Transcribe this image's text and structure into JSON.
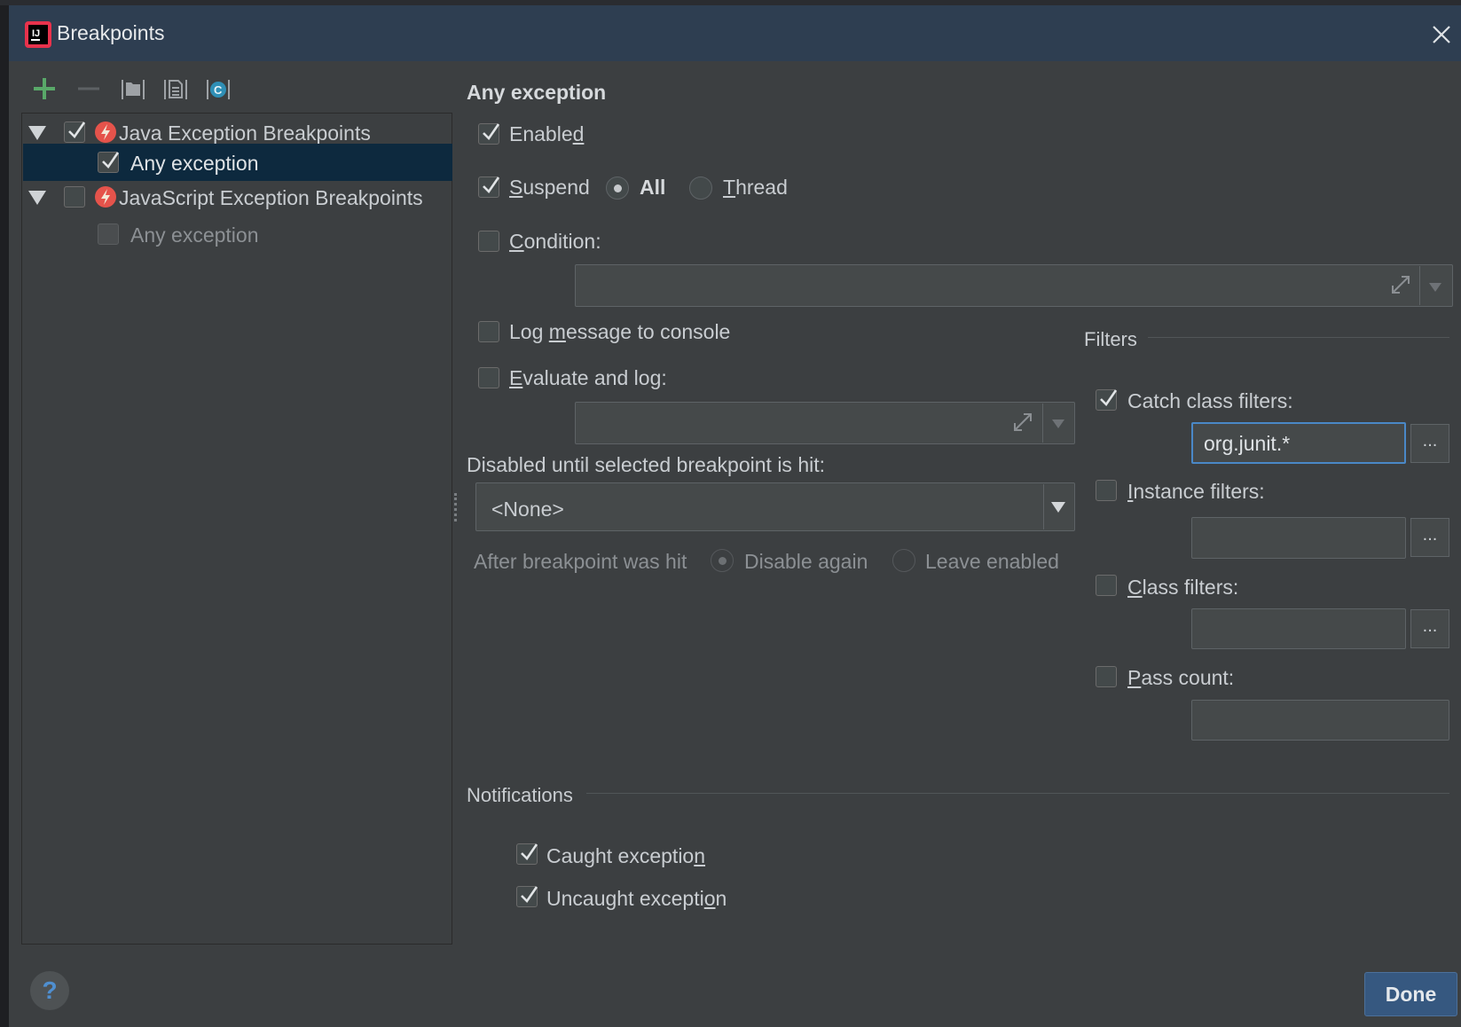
{
  "window": {
    "title": "Breakpoints"
  },
  "toolbar": {
    "add_icon": "plus-icon",
    "remove_icon": "minus-icon",
    "group_by_package_icon": "folder-icon",
    "group_by_file_icon": "file-icon",
    "group_by_class_icon": "class-icon"
  },
  "tree": {
    "items": [
      {
        "label": "Java Exception Breakpoints",
        "checked": true,
        "expanded": true
      },
      {
        "label": "Any exception",
        "checked": true,
        "selected": true
      },
      {
        "label": "JavaScript Exception Breakpoints",
        "checked": false,
        "expanded": true
      },
      {
        "label": "Any exception",
        "checked": false,
        "disabled": true
      }
    ]
  },
  "details": {
    "heading": "Any exception",
    "enabled": {
      "prefix": "Enable",
      "underlined": "d"
    },
    "suspend": {
      "underlined": "S",
      "rest": "uspend"
    },
    "suspend_all": "All",
    "suspend_thread": {
      "underlined": "T",
      "rest": "hread"
    },
    "condition": {
      "underlined": "C",
      "rest": "ondition:"
    },
    "log_message": {
      "prefix": "Log ",
      "underlined": "m",
      "rest": "essage to console"
    },
    "evaluate": {
      "underlined": "E",
      "rest": "valuate and log:"
    },
    "disabled_until_label": "Disabled until selected breakpoint is hit:",
    "disabled_until_value": "<None>",
    "after_hit_label": "After breakpoint was hit",
    "disable_again": "Disable again",
    "leave_enabled": "Leave enabled"
  },
  "filters": {
    "section_title": "Filters",
    "catch_class_label": "Catch class filters:",
    "catch_class_value": "org.junit.*",
    "instance": {
      "underlined": "I",
      "rest": "nstance filters:"
    },
    "class": {
      "underlined": "C",
      "rest": "lass filters:"
    },
    "pass_count": {
      "underlined": "P",
      "rest": "ass count:"
    },
    "browse_label": "..."
  },
  "notifications": {
    "section_title": "Notifications",
    "caught": {
      "prefix": "Caught exceptio",
      "underlined": "n"
    },
    "uncaught": {
      "prefix": "Uncaught excepti",
      "underlined": "o",
      "rest": "n"
    }
  },
  "footer": {
    "help_label": "?",
    "done_label": "Done"
  },
  "colors": {
    "titlebar": "#2e3e51",
    "dialog": "#3c3f41",
    "selection": "#0d293e",
    "accent_green": "#59a869",
    "done_button": "#365880"
  }
}
